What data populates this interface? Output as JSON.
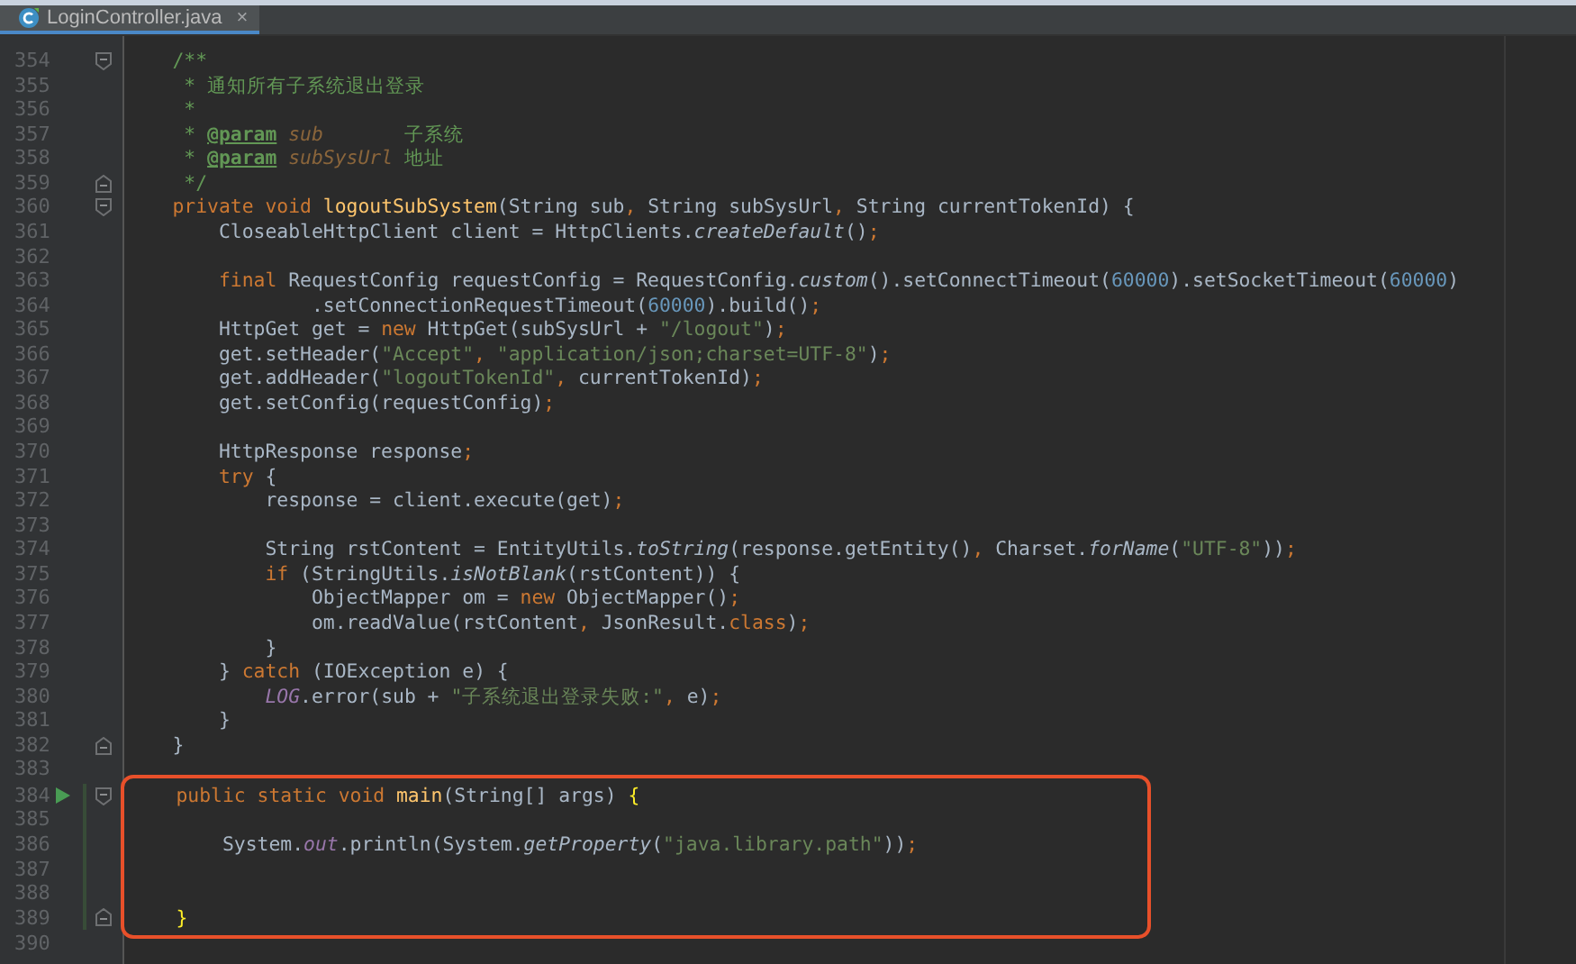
{
  "tabs": [
    {
      "label": "LoginController.java",
      "close": "×",
      "selected": true
    }
  ],
  "lines": [
    {
      "number": "354",
      "kind": "fold-start",
      "tokens": [
        {
          "text": "    /**",
          "kind": "comment"
        }
      ]
    },
    {
      "number": "355",
      "kind": "plain",
      "tokens": [
        {
          "text": "     * 通知所有子系统退出登录",
          "kind": "comment"
        }
      ]
    },
    {
      "number": "356",
      "kind": "plain",
      "tokens": [
        {
          "text": "     *",
          "kind": "comment"
        }
      ]
    },
    {
      "number": "357",
      "kind": "plain",
      "tokens": [
        {
          "text": "     * ",
          "kind": "comment"
        },
        {
          "text": "@param",
          "kind": "doctag"
        },
        {
          "text": " sub",
          "kind": "docparam"
        },
        {
          "text": "       子系统",
          "kind": "comment"
        }
      ]
    },
    {
      "number": "358",
      "kind": "plain",
      "tokens": [
        {
          "text": "     * ",
          "kind": "comment"
        },
        {
          "text": "@param",
          "kind": "doctag"
        },
        {
          "text": " subSysUrl",
          "kind": "docparam"
        },
        {
          "text": " 地址",
          "kind": "comment"
        }
      ]
    },
    {
      "number": "359",
      "kind": "fold-end",
      "tokens": [
        {
          "text": "     */",
          "kind": "comment"
        }
      ]
    },
    {
      "number": "360",
      "kind": "fold-start",
      "tokens": [
        {
          "text": "    private void ",
          "kind": "keyword"
        },
        {
          "text": "logoutSubSystem",
          "kind": "method"
        },
        {
          "text": "(String sub",
          "kind": "plain"
        },
        {
          "text": ", ",
          "kind": "keyword"
        },
        {
          "text": "String subSysUrl",
          "kind": "plain"
        },
        {
          "text": ", ",
          "kind": "keyword"
        },
        {
          "text": "String currentTokenId) {",
          "kind": "plain"
        }
      ]
    },
    {
      "number": "361",
      "kind": "plain",
      "tokens": [
        {
          "text": "        CloseableHttpClient client = HttpClients.",
          "kind": "plain"
        },
        {
          "text": "createDefault",
          "kind": "static"
        },
        {
          "text": "()",
          "kind": "plain"
        },
        {
          "text": ";",
          "kind": "keyword"
        }
      ]
    },
    {
      "number": "362",
      "kind": "plain"
    },
    {
      "number": "363",
      "kind": "plain",
      "tokens": [
        {
          "text": "        final",
          "kind": "keyword"
        },
        {
          "text": " RequestConfig requestConfig = RequestConfig.",
          "kind": "plain"
        },
        {
          "text": "custom",
          "kind": "static"
        },
        {
          "text": "().setConnectTimeout(",
          "kind": "plain"
        },
        {
          "text": "60000",
          "kind": "number"
        },
        {
          "text": ").setSocketTimeout(",
          "kind": "plain"
        },
        {
          "text": "60000",
          "kind": "number"
        },
        {
          "text": ")",
          "kind": "plain"
        }
      ]
    },
    {
      "number": "364",
      "kind": "plain",
      "tokens": [
        {
          "text": "                .setConnectionRequestTimeout(",
          "kind": "plain"
        },
        {
          "text": "60000",
          "kind": "number"
        },
        {
          "text": ").build()",
          "kind": "plain"
        },
        {
          "text": ";",
          "kind": "keyword"
        }
      ]
    },
    {
      "number": "365",
      "kind": "plain",
      "tokens": [
        {
          "text": "        HttpGet get = ",
          "kind": "plain"
        },
        {
          "text": "new",
          "kind": "keyword"
        },
        {
          "text": " HttpGet(subSysUrl + ",
          "kind": "plain"
        },
        {
          "text": "\"/logout\"",
          "kind": "string"
        },
        {
          "text": ")",
          "kind": "plain"
        },
        {
          "text": ";",
          "kind": "keyword"
        }
      ]
    },
    {
      "number": "366",
      "kind": "plain",
      "tokens": [
        {
          "text": "        get.setHeader(",
          "kind": "plain"
        },
        {
          "text": "\"Accept\"",
          "kind": "string"
        },
        {
          "text": ", ",
          "kind": "keyword"
        },
        {
          "text": "\"application/json;charset=UTF-8\"",
          "kind": "string"
        },
        {
          "text": ")",
          "kind": "plain"
        },
        {
          "text": ";",
          "kind": "keyword"
        }
      ]
    },
    {
      "number": "367",
      "kind": "plain",
      "tokens": [
        {
          "text": "        get.addHeader(",
          "kind": "plain"
        },
        {
          "text": "\"logoutTokenId\"",
          "kind": "string"
        },
        {
          "text": ", ",
          "kind": "keyword"
        },
        {
          "text": "currentTokenId)",
          "kind": "plain"
        },
        {
          "text": ";",
          "kind": "keyword"
        }
      ]
    },
    {
      "number": "368",
      "kind": "plain",
      "tokens": [
        {
          "text": "        get.setConfig(requestConfig)",
          "kind": "plain"
        },
        {
          "text": ";",
          "kind": "keyword"
        }
      ]
    },
    {
      "number": "369",
      "kind": "plain"
    },
    {
      "number": "370",
      "kind": "plain",
      "tokens": [
        {
          "text": "        HttpResponse response",
          "kind": "plain"
        },
        {
          "text": ";",
          "kind": "keyword"
        }
      ]
    },
    {
      "number": "371",
      "kind": "plain",
      "tokens": [
        {
          "text": "        try",
          "kind": "keyword"
        },
        {
          "text": " {",
          "kind": "plain"
        }
      ]
    },
    {
      "number": "372",
      "kind": "plain",
      "tokens": [
        {
          "text": "            response = client.execute(get)",
          "kind": "plain"
        },
        {
          "text": ";",
          "kind": "keyword"
        }
      ]
    },
    {
      "number": "373",
      "kind": "plain"
    },
    {
      "number": "374",
      "kind": "plain",
      "tokens": [
        {
          "text": "            String rstContent = EntityUtils.",
          "kind": "plain"
        },
        {
          "text": "toString",
          "kind": "static"
        },
        {
          "text": "(response.getEntity()",
          "kind": "plain"
        },
        {
          "text": ", ",
          "kind": "keyword"
        },
        {
          "text": "Charset.",
          "kind": "plain"
        },
        {
          "text": "forName",
          "kind": "static"
        },
        {
          "text": "(",
          "kind": "plain"
        },
        {
          "text": "\"UTF-8\"",
          "kind": "string"
        },
        {
          "text": "))",
          "kind": "plain"
        },
        {
          "text": ";",
          "kind": "keyword"
        }
      ]
    },
    {
      "number": "375",
      "kind": "plain",
      "tokens": [
        {
          "text": "            if",
          "kind": "keyword"
        },
        {
          "text": " (StringUtils.",
          "kind": "plain"
        },
        {
          "text": "isNotBlank",
          "kind": "static"
        },
        {
          "text": "(rstContent)) {",
          "kind": "plain"
        }
      ]
    },
    {
      "number": "376",
      "kind": "plain",
      "tokens": [
        {
          "text": "                ObjectMapper om = ",
          "kind": "plain"
        },
        {
          "text": "new",
          "kind": "keyword"
        },
        {
          "text": " ObjectMapper()",
          "kind": "plain"
        },
        {
          "text": ";",
          "kind": "keyword"
        }
      ]
    },
    {
      "number": "377",
      "kind": "plain",
      "tokens": [
        {
          "text": "                om.readValue(rstContent",
          "kind": "plain"
        },
        {
          "text": ", ",
          "kind": "keyword"
        },
        {
          "text": "JsonResult.",
          "kind": "plain"
        },
        {
          "text": "class",
          "kind": "keyword"
        },
        {
          "text": ")",
          "kind": "plain"
        },
        {
          "text": ";",
          "kind": "keyword"
        }
      ]
    },
    {
      "number": "378",
      "kind": "plain",
      "tokens": [
        {
          "text": "            }",
          "kind": "plain"
        }
      ]
    },
    {
      "number": "379",
      "kind": "plain",
      "tokens": [
        {
          "text": "        } ",
          "kind": "plain"
        },
        {
          "text": "catch",
          "kind": "keyword"
        },
        {
          "text": " (IOException e) {",
          "kind": "plain"
        }
      ]
    },
    {
      "number": "380",
      "kind": "plain",
      "tokens": [
        {
          "text": "            LOG",
          "kind": "field"
        },
        {
          "text": ".error(sub + ",
          "kind": "plain"
        },
        {
          "text": "\"子系统退出登录失败:\"",
          "kind": "string"
        },
        {
          "text": ", ",
          "kind": "keyword"
        },
        {
          "text": "e)",
          "kind": "plain"
        },
        {
          "text": ";",
          "kind": "keyword"
        }
      ]
    },
    {
      "number": "381",
      "kind": "plain",
      "tokens": [
        {
          "text": "        }",
          "kind": "plain"
        }
      ]
    },
    {
      "number": "382",
      "kind": "fold-end",
      "tokens": [
        {
          "text": "    }",
          "kind": "plain"
        }
      ]
    },
    {
      "number": "383",
      "kind": "plain"
    }
  ],
  "highlight_box": {
    "lines": [
      {
        "number": "384",
        "kind": "run-fold-start",
        "tokens": [
          {
            "text": "    public static void ",
            "kind": "keyword"
          },
          {
            "text": "main",
            "kind": "method"
          },
          {
            "text": "(String[] args) ",
            "kind": "plain"
          },
          {
            "text": "{",
            "kind": "brace"
          }
        ]
      },
      {
        "number": "385",
        "kind": "plain"
      },
      {
        "number": "386",
        "kind": "plain",
        "tokens": [
          {
            "text": "        System.",
            "kind": "plain"
          },
          {
            "text": "out",
            "kind": "field"
          },
          {
            "text": ".println(System.",
            "kind": "plain"
          },
          {
            "text": "getProperty",
            "kind": "static"
          },
          {
            "text": "(",
            "kind": "plain"
          },
          {
            "text": "\"java.library.path\"",
            "kind": "string"
          },
          {
            "text": "))",
            "kind": "plain"
          },
          {
            "text": ";",
            "kind": "keyword"
          }
        ]
      },
      {
        "number": "387",
        "kind": "plain"
      },
      {
        "number": "388",
        "kind": "plain"
      },
      {
        "number": "389",
        "kind": "fold-end",
        "tokens": [
          {
            "text": "    }",
            "kind": "brace"
          }
        ]
      }
    ]
  },
  "lines_after": [
    {
      "number": "390"
    }
  ]
}
